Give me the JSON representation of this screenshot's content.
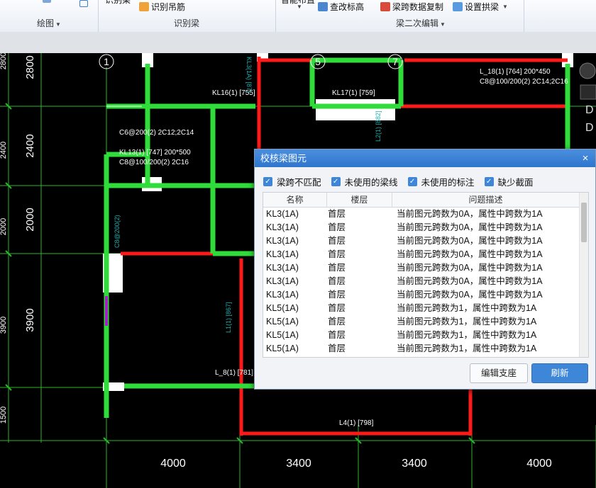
{
  "ribbon": {
    "groups": [
      {
        "label": "绘图"
      },
      {
        "label": "识别梁",
        "buttons": [
          "识别梁",
          "识别吊筋"
        ]
      },
      {
        "label": "",
        "buttons": [
          "智能布置"
        ]
      },
      {
        "label": "梁二次编辑",
        "buttons": [
          "查改标高",
          "梁跨数据复制",
          "设置拱梁"
        ]
      }
    ]
  },
  "cad": {
    "dimensions_left": [
      "2800",
      "2400",
      "2000",
      "3900",
      "1500"
    ],
    "dimensions_bottom": [
      "4000",
      "3400",
      "3400",
      "4000"
    ],
    "axis_bubbles": [
      "1",
      "5",
      "7"
    ],
    "beam_labels": [
      "KL16(1) [755]",
      "KL17(1) [759]",
      "KL13(1) [747] 200*500",
      "C8@100/200(2) 2C16",
      "C6@200(2) 2C12;2C14",
      "L_18(1) [764] 200*450",
      "C8@100/200(2) 2C14;2C16",
      "L1(1) [867]",
      "L_8(1) [781]",
      "L4(1) [798]",
      "KL3(1A) [87]",
      "L2(1) [882]",
      "C8@200(2)"
    ]
  },
  "dialog": {
    "title": "校核梁图元",
    "close": "×",
    "filters": [
      {
        "label": "梁跨不匹配",
        "checked": true
      },
      {
        "label": "未使用的梁线",
        "checked": true
      },
      {
        "label": "未使用的标注",
        "checked": true
      },
      {
        "label": "缺少截面",
        "checked": true
      }
    ],
    "columns": [
      "名称",
      "楼层",
      "问题描述"
    ],
    "rows": [
      [
        "KL3(1A)",
        "首层",
        "当前图元跨数为0A，属性中跨数为1A"
      ],
      [
        "KL3(1A)",
        "首层",
        "当前图元跨数为0A，属性中跨数为1A"
      ],
      [
        "KL3(1A)",
        "首层",
        "当前图元跨数为0A，属性中跨数为1A"
      ],
      [
        "KL3(1A)",
        "首层",
        "当前图元跨数为0A，属性中跨数为1A"
      ],
      [
        "KL3(1A)",
        "首层",
        "当前图元跨数为0A，属性中跨数为1A"
      ],
      [
        "KL3(1A)",
        "首层",
        "当前图元跨数为0A，属性中跨数为1A"
      ],
      [
        "KL3(1A)",
        "首层",
        "当前图元跨数为0A，属性中跨数为1A"
      ],
      [
        "KL5(1A)",
        "首层",
        "当前图元跨数为1，属性中跨数为1A"
      ],
      [
        "KL5(1A)",
        "首层",
        "当前图元跨数为1，属性中跨数为1A"
      ],
      [
        "KL5(1A)",
        "首层",
        "当前图元跨数为1，属性中跨数为1A"
      ],
      [
        "KL5(1A)",
        "首层",
        "当前图元跨数为1，属性中跨数为1A"
      ]
    ],
    "buttons": {
      "edit": "编辑支座",
      "refresh": "刷新"
    }
  },
  "colors": {
    "beam_green": "#2fdc3a",
    "beam_red": "#ff1a1a",
    "grid_green": "#2bb52b",
    "text_cyan": "#1ab0b0",
    "accent": "#3d86d8"
  }
}
